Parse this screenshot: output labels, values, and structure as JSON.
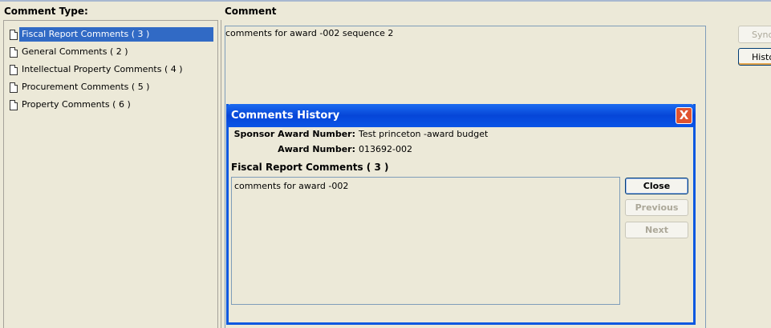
{
  "header": {
    "comment_type_label": "Comment Type:",
    "comment_label": "Comment"
  },
  "comment_types": [
    {
      "label": "Fiscal Report Comments ( 3 )",
      "selected": true
    },
    {
      "label": "General Comments ( 2 )",
      "selected": false
    },
    {
      "label": "Intellectual Property Comments ( 4 )",
      "selected": false
    },
    {
      "label": "Procurement Comments ( 5 )",
      "selected": false
    },
    {
      "label": "Property Comments ( 6 )",
      "selected": false
    }
  ],
  "comment_text": "comments for award -002 sequence 2",
  "side_buttons": {
    "sync_label": "Sync",
    "history_label": "History"
  },
  "dialog": {
    "title": "Comments History",
    "sponsor_award_number_label": "Sponsor Award Number:",
    "sponsor_award_number_value": "Test  princeton -award budget",
    "award_number_label": "Award Number:",
    "award_number_value": "013692-002",
    "section_label": "Fiscal Report Comments ( 3 )",
    "history_text": "comments for award -002",
    "close_label": "Close",
    "previous_label": "Previous",
    "next_label": "Next",
    "close_icon": "X"
  },
  "colors": {
    "selection": "#316ac5",
    "title_bar": "#0a54e6",
    "window_bg": "#ece9d8",
    "close_button": "#e0532f"
  }
}
